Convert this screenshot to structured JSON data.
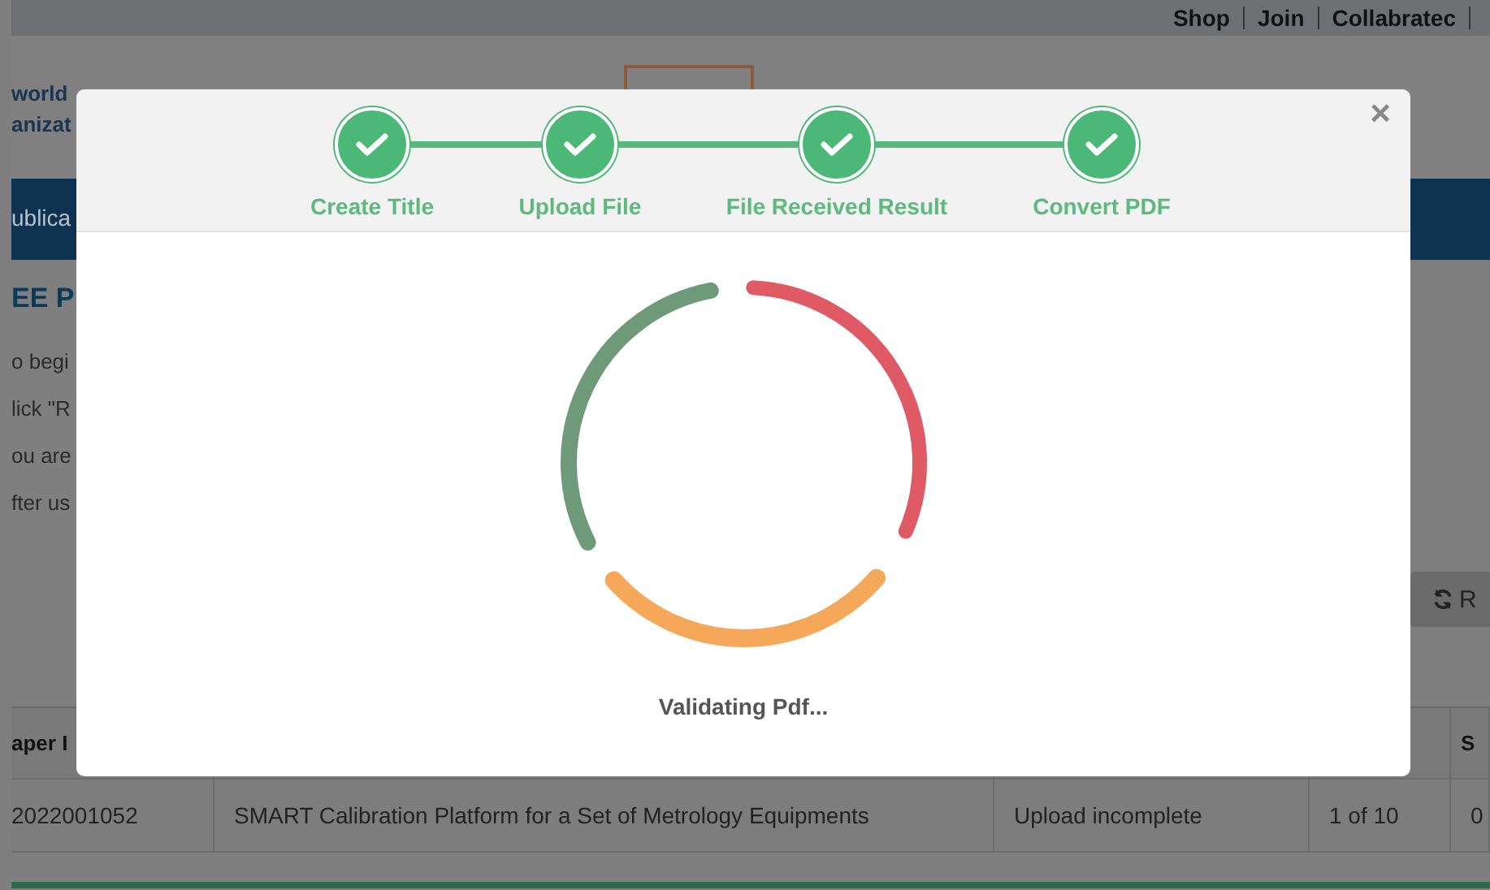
{
  "top_links": [
    "Shop",
    "Join",
    "Collabratec"
  ],
  "header": {
    "title_lines": [
      "world",
      "anizat"
    ]
  },
  "nav": {
    "item": "ublica"
  },
  "page": {
    "heading": "EE P",
    "paragraphs": [
      "o begi",
      "lick \"R",
      "ou are",
      "fter us"
    ]
  },
  "refresh_button": {
    "label": "R"
  },
  "table": {
    "columns": [
      "aper I",
      "S"
    ],
    "rows": [
      {
        "cells": [
          "2022001052",
          "SMART Calibration Platform for a Set of Metrology Equipments",
          "Upload incomplete",
          "1 of 10",
          "0"
        ]
      }
    ]
  },
  "modal": {
    "close": "×",
    "steps": [
      {
        "label": "Create Title",
        "completed": true
      },
      {
        "label": "Upload File",
        "completed": true
      },
      {
        "label": "File Received Result",
        "completed": true
      },
      {
        "label": "Convert PDF",
        "completed": true
      }
    ],
    "status": "Validating Pdf..."
  }
}
